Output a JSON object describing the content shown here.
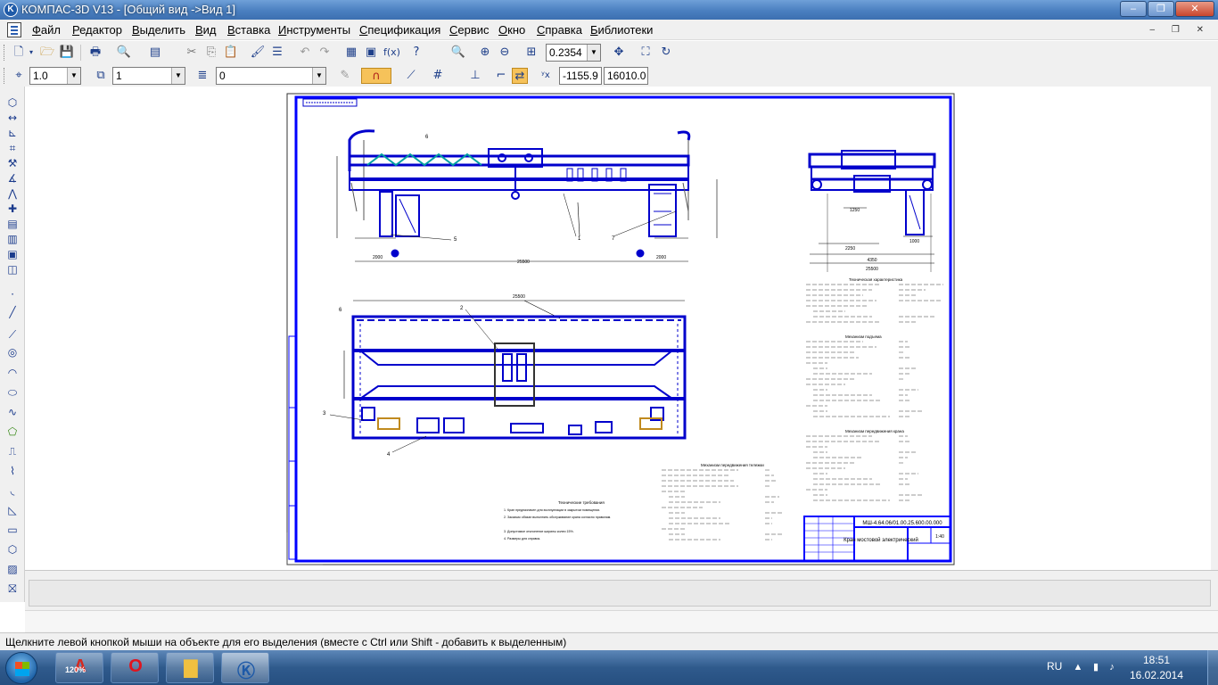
{
  "window": {
    "title": "КОМПАС-3D V13 - [Общий вид ->Вид 1]",
    "buttons": {
      "minimize": "–",
      "restore": "❐",
      "close": "✕"
    }
  },
  "menu": {
    "items": [
      "Файл",
      "Редактор",
      "Выделить",
      "Вид",
      "Вставка",
      "Инструменты",
      "Спецификация",
      "Сервис",
      "Окно",
      "Справка",
      "Библиотеки"
    ],
    "mdi_buttons": "– ❐ ✕"
  },
  "toolbar_standard": {
    "zoom_value": "0.2354"
  },
  "toolbar_current_state": {
    "line_scale": "1.0",
    "layer_state": "1",
    "layer": "0",
    "coord_x": "-1155.9",
    "coord_y": "16010.0"
  },
  "drawing": {
    "main_title": "Кран мостовой электрический",
    "doc_number": "МШ-4.64.06/01.00.25.600.00.000",
    "mass_scale": "1:40",
    "notes_title": "Технические требования",
    "notes": [
      "1. Кран предназначен для эксплуатации в закрытом помещении.",
      "2. Заказчик обязан выполнить обслуживание крана согласно правилам.",
      "3. Допустимое отклонение ширины колеи 15%.",
      "4. Размеры для справок."
    ],
    "specs_title": "Техническая характеристика",
    "specs_sub1": "Механизм подъема",
    "specs_sub2": "Механизм передвижения крана",
    "specs_sub3": "Механизм передвижения тележки",
    "dimensions": {
      "span_front": "25500",
      "span_top": "25500",
      "left_bottom": "2000",
      "right_bottom": "2000",
      "side_width": "4350",
      "side_base": "2250",
      "side_wheel": "1000",
      "side_trolley": "1250"
    },
    "callouts": [
      "1",
      "2",
      "3",
      "4",
      "5",
      "6",
      "7"
    ]
  },
  "status": {
    "hint": "Щелкните левой кнопкой мыши на объекте для его выделения (вместе с Ctrl или Shift - добавить к выделенным)"
  },
  "taskbar": {
    "app1_badge": "120%",
    "lang": "RU",
    "time": "18:51",
    "date": "16.02.2014"
  },
  "colors": {
    "drawing_blue": "#0000cc",
    "frame_blue": "#0000ff",
    "active_orange": "#f6c25a",
    "ghost_teal": "#00a0a0"
  }
}
